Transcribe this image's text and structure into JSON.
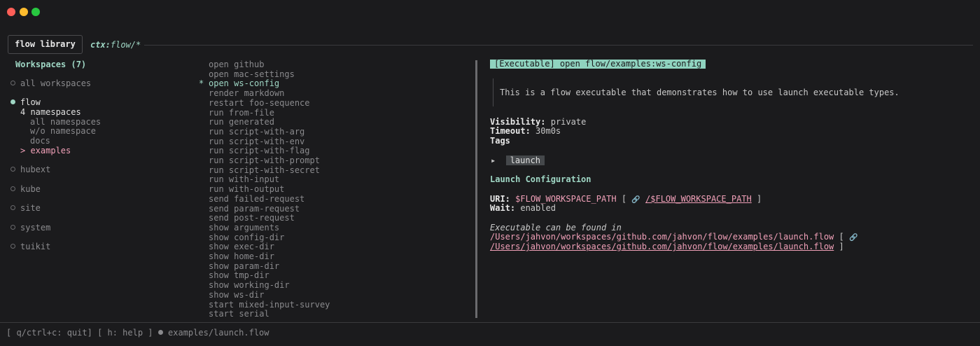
{
  "window": {
    "traffic_lights": [
      "close",
      "minimize",
      "zoom"
    ]
  },
  "tabs": {
    "active": "flow library",
    "context_label": "ctx:",
    "context_value": "flow/*"
  },
  "workspaces": {
    "title": "Workspaces (7)",
    "items": [
      {
        "label": "all workspaces"
      },
      {
        "label": "flow"
      },
      {
        "label": "hubext"
      },
      {
        "label": "kube"
      },
      {
        "label": "site"
      },
      {
        "label": "system"
      },
      {
        "label": "tuikit"
      }
    ],
    "namespaces": {
      "count_label": "4 namespaces",
      "items": [
        "all namespaces",
        "w/o namespace",
        "docs",
        "> examples"
      ]
    }
  },
  "executables": {
    "selected_marker": "*",
    "items": [
      "open github",
      "open mac-settings",
      "open ws-config",
      "render markdown",
      "restart foo-sequence",
      "run from-file",
      "run generated",
      "run script-with-arg",
      "run script-with-env",
      "run script-with-flag",
      "run script-with-prompt",
      "run script-with-secret",
      "run with-input",
      "run with-output",
      "send failed-request",
      "send param-request",
      "send post-request",
      "show arguments",
      "show config-dir",
      "show exec-dir",
      "show home-dir",
      "show param-dir",
      "show tmp-dir",
      "show working-dir",
      "show ws-dir",
      "start mixed-input-survey",
      "start serial"
    ]
  },
  "detail": {
    "header": "[Executable] open flow/examples:ws-config",
    "description": "This is a flow executable that demonstrates how to use launch executable types.",
    "visibility_label": "Visibility:",
    "visibility_value": "private",
    "timeout_label": "Timeout:",
    "timeout_value": "30m0s",
    "tags_label": "Tags",
    "tag_arrow": "▸",
    "tag": "launch",
    "launch_heading": "Launch Configuration",
    "uri_label": "URI:",
    "uri_value": "$FLOW_WORKSPACE_PATH",
    "uri_bracket_open": "[",
    "link_icon": "🔗",
    "uri_link": "/$FLOW_WORKSPACE_PATH",
    "uri_bracket_close": "]",
    "wait_label": "Wait:",
    "wait_value": "enabled",
    "found_in_label": "Executable can be found in",
    "path": "/Users/jahvon/workspaces/github.com/jahvon/flow/examples/launch.flow",
    "path_bracket_open": "[",
    "path_link": "/Users/jahvon/workspaces/github.com/jahvon/flow/examples/launch.flow",
    "path_bracket_close": "]"
  },
  "status_bar": {
    "quit_hint": "[ q/ctrl+c: quit]",
    "help_hint": "[ h: help ]",
    "file": "examples/launch.flow"
  }
}
